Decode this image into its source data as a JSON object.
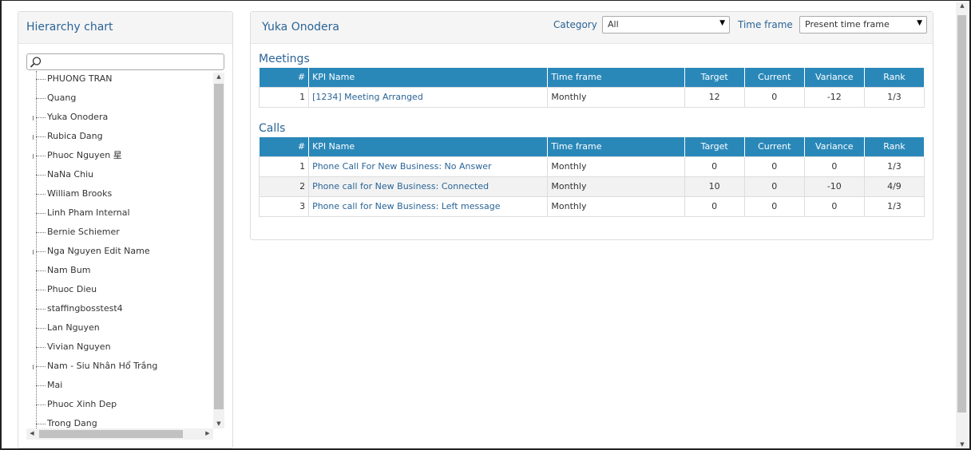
{
  "sidebar": {
    "title": "Hierarchy chart",
    "search_placeholder": "",
    "items": [
      {
        "label": "PHUONG TRAN",
        "expandable": false
      },
      {
        "label": "Quang",
        "expandable": false
      },
      {
        "label": "Yuka Onodera",
        "expandable": true
      },
      {
        "label": "Rubica Dang",
        "expandable": true
      },
      {
        "label": "Phuoc Nguyen 星",
        "expandable": true
      },
      {
        "label": "NaNa Chiu",
        "expandable": false
      },
      {
        "label": "William Brooks",
        "expandable": false
      },
      {
        "label": "Linh Pham Internal",
        "expandable": false
      },
      {
        "label": "Bernie Schiemer",
        "expandable": false
      },
      {
        "label": "Nga Nguyen Edit Name",
        "expandable": true
      },
      {
        "label": "Nam Bum",
        "expandable": false
      },
      {
        "label": "Phuoc Dieu",
        "expandable": false
      },
      {
        "label": "staffingbosstest4",
        "expandable": false
      },
      {
        "label": "Lan Nguyen",
        "expandable": false
      },
      {
        "label": "Vivian Nguyen",
        "expandable": false
      },
      {
        "label": "Nam - Siu Nhân Hổ Trắng",
        "expandable": true
      },
      {
        "label": "Mai",
        "expandable": false
      },
      {
        "label": "Phuoc Xinh Dep",
        "expandable": false
      },
      {
        "label": "Trong Dang",
        "expandable": false
      }
    ]
  },
  "main": {
    "person_name": "Yuka Onodera",
    "category_label": "Category",
    "category_value": "All",
    "timeframe_label": "Time frame",
    "timeframe_value": "Present time frame",
    "columns": [
      "#",
      "KPI Name",
      "Time frame",
      "Target",
      "Current",
      "Variance",
      "Rank"
    ],
    "sections": [
      {
        "title": "Meetings",
        "rows": [
          {
            "num": "1",
            "name": "[1234] Meeting Arranged",
            "timeframe": "Monthly",
            "target": "12",
            "current": "0",
            "variance": "-12",
            "rank": "1/3"
          }
        ]
      },
      {
        "title": "Calls",
        "rows": [
          {
            "num": "1",
            "name": "Phone Call For New Business: No Answer",
            "timeframe": "Monthly",
            "target": "0",
            "current": "0",
            "variance": "0",
            "rank": "1/3"
          },
          {
            "num": "2",
            "name": "Phone call for New Business: Connected",
            "timeframe": "Monthly",
            "target": "10",
            "current": "0",
            "variance": "-10",
            "rank": "4/9"
          },
          {
            "num": "3",
            "name": "Phone call for New Business: Left message",
            "timeframe": "Monthly",
            "target": "0",
            "current": "0",
            "variance": "0",
            "rank": "1/3"
          }
        ]
      }
    ]
  },
  "colors": {
    "accent": "#2a6496",
    "table_header": "#2a88b9"
  }
}
